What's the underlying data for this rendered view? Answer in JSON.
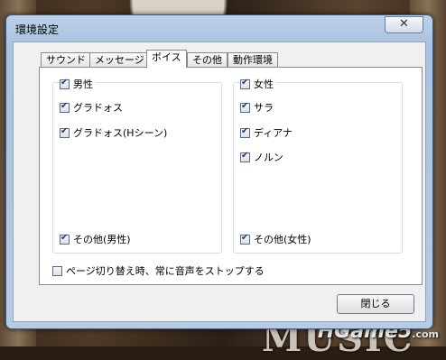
{
  "window": {
    "title": "環境設定",
    "close_glyph": "✕"
  },
  "tabs": [
    {
      "label": "サウンド",
      "active": false
    },
    {
      "label": "メッセージ",
      "active": false
    },
    {
      "label": "ボイス",
      "active": true
    },
    {
      "label": "その他",
      "active": false
    },
    {
      "label": "動作環境",
      "active": false
    }
  ],
  "male_group": {
    "header": {
      "label": "男性",
      "checked": true
    },
    "items": [
      {
        "label": "グラドォス",
        "checked": true
      },
      {
        "label": "グラドォス(Hシーン)",
        "checked": true
      }
    ],
    "other": {
      "label": "その他(男性)",
      "checked": true
    }
  },
  "female_group": {
    "header": {
      "label": "女性",
      "checked": true
    },
    "items": [
      {
        "label": "サラ",
        "checked": true
      },
      {
        "label": "ディアナ",
        "checked": true
      },
      {
        "label": "ノルン",
        "checked": true
      }
    ],
    "other": {
      "label": "その他(女性)",
      "checked": true
    }
  },
  "stop_voice_option": {
    "label": "ページ切り替え時、常に音声をストップする",
    "checked": false
  },
  "close_button": {
    "label": "閉じる"
  },
  "background": {
    "logo_text": "MUSIC",
    "watermark": "HGame5",
    "watermark_suffix": ".com"
  }
}
